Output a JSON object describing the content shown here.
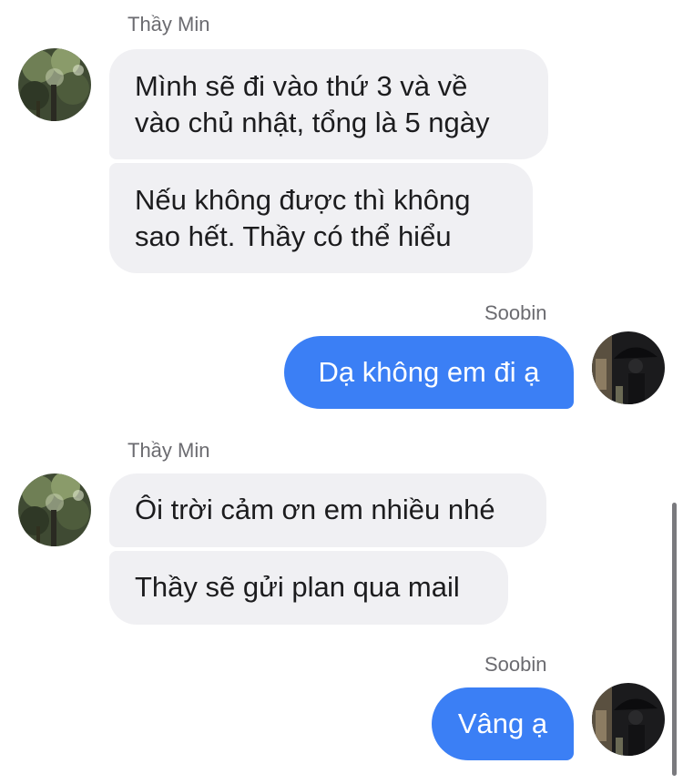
{
  "conversation": {
    "messages": [
      {
        "sender": "Thầy Min",
        "direction": "incoming",
        "bubbles": [
          [
            "Mình sẽ đi vào thứ 3 và về",
            "vào chủ nhật, tổng là 5 ngày"
          ],
          [
            "Nếu không được thì không",
            "sao hết. Thầy có thể hiểu"
          ]
        ]
      },
      {
        "sender": "Soobin",
        "direction": "outgoing",
        "bubbles": [
          [
            "Dạ không em đi ạ"
          ]
        ]
      },
      {
        "sender": "Thầy Min",
        "direction": "incoming",
        "bubbles": [
          [
            "Ôi trời cảm ơn em nhiều nhé"
          ],
          [
            "Thầy sẽ gửi plan qua mail"
          ]
        ]
      },
      {
        "sender": "Soobin",
        "direction": "outgoing",
        "bubbles": [
          [
            "Vâng ạ"
          ]
        ]
      }
    ]
  },
  "colors": {
    "incoming_bubble": "#f0f0f3",
    "outgoing_bubble": "#3b7ff5",
    "sender_name": "#6b6b70"
  }
}
